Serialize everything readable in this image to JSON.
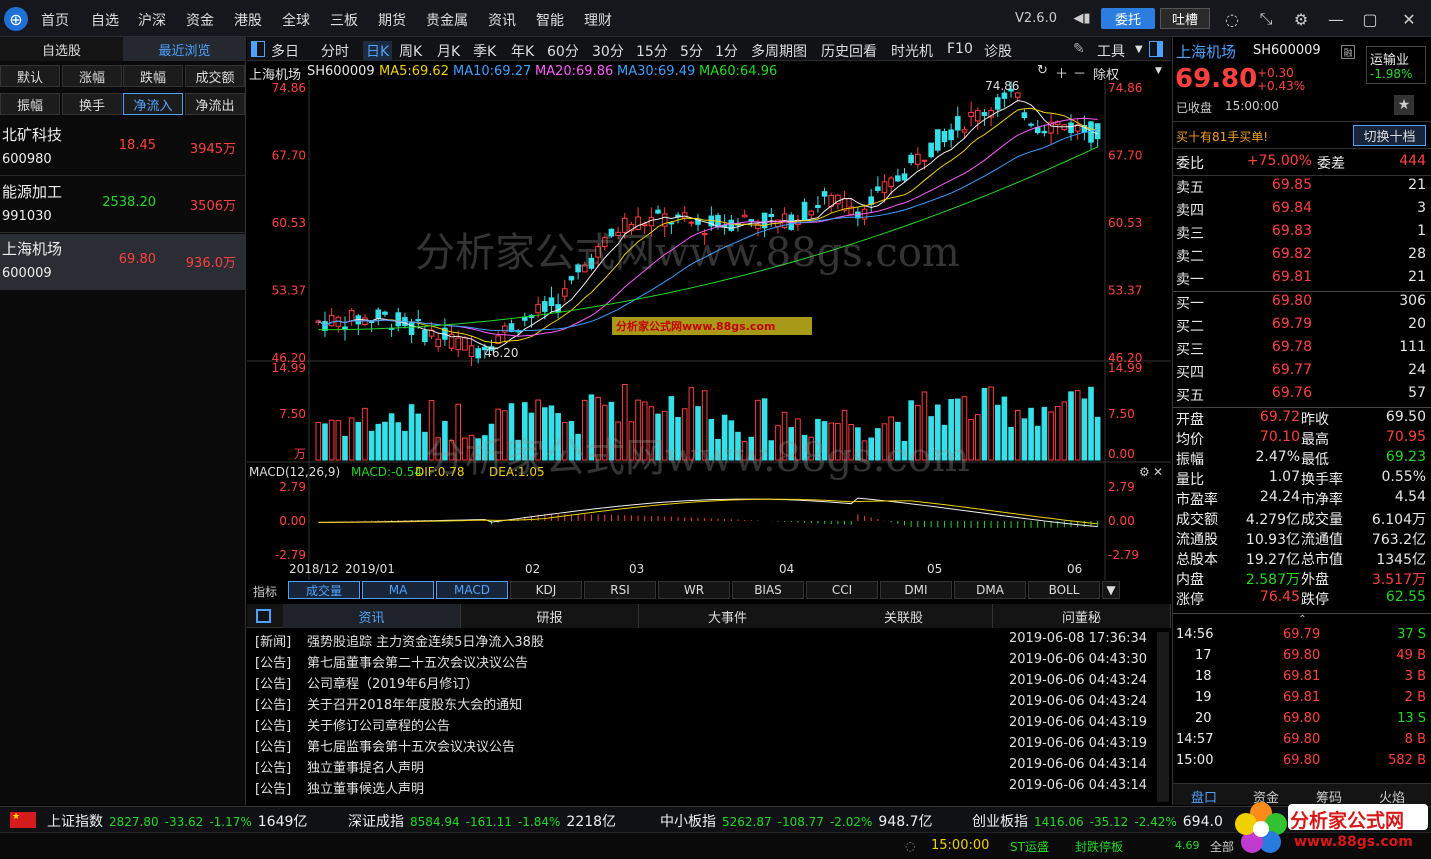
{
  "topnav": {
    "items": [
      "首页",
      "自选",
      "沪深",
      "资金",
      "港股",
      "全球",
      "三板",
      "期货",
      "贵金属",
      "资讯",
      "智能",
      "理财"
    ],
    "version": "V2.6.0",
    "weituo": "委托",
    "tucao": "吐槽"
  },
  "left": {
    "tabs": [
      "自选股",
      "最近浏览"
    ],
    "sort_row1": [
      "默认",
      "涨幅",
      "跌幅",
      "成交额"
    ],
    "sort_row2": [
      "振幅",
      "换手",
      "净流入",
      "净流出"
    ],
    "stocks": [
      {
        "name": "北矿科技",
        "code": "600980",
        "price": "18.45",
        "amount": "3945万",
        "color": "#ff4040"
      },
      {
        "name": "能源加工",
        "code": "991030",
        "price": "2538.20",
        "amount": "3506万",
        "color": "#22d822"
      },
      {
        "name": "上海机场",
        "code": "600009",
        "price": "69.80",
        "amount": "936.0万",
        "color": "#ff4040"
      }
    ]
  },
  "toolbar": {
    "periods": [
      "多日",
      "分时",
      "日K",
      "周K",
      "月K",
      "季K",
      "年K",
      "60分",
      "30分",
      "15分",
      "5分",
      "1分",
      "多周期图",
      "历史回看",
      "时光机",
      "F10",
      "诊股"
    ],
    "tools": "工具",
    "fuquan": "除权"
  },
  "chart_info": {
    "name": "上海机场",
    "code": "SH600009",
    "ma5": "MA5:69.62",
    "ma10": "MA10:69.27",
    "ma20": "MA20:69.86",
    "ma30": "MA30:69.49",
    "ma60": "MA60:64.96"
  },
  "chart_data": {
    "type": "candlestick",
    "price_ticks": [
      "74.86",
      "67.70",
      "60.53",
      "53.37",
      "46.20"
    ],
    "volume_ticks": [
      "14.99",
      "7.50",
      "万"
    ],
    "volume_ticks_right": [
      "14.99",
      "7.50",
      "0.00"
    ],
    "macd_ticks": [
      "2.79",
      "0.00",
      "-2.79"
    ],
    "x_ticks": [
      "2018/12",
      "2019/01",
      "02",
      "03",
      "04",
      "05",
      "06"
    ],
    "high_label": "74.86",
    "low_label": "46.20",
    "macd_title": "MACD(12,26,9)",
    "macd_vals": [
      "MACD:-0.54",
      "DIF:0.78",
      "DEA:1.05"
    ],
    "colors": {
      "up": "#ff3b3b",
      "down": "#35e0e8",
      "ma5": "#f0f0f0",
      "ma10": "#f0d200",
      "ma20": "#ff5cff",
      "ma30": "#3aa0ff",
      "ma60": "#22d822"
    }
  },
  "indicator_tabs": [
    "成交量",
    "MA",
    "MACD",
    "KDJ",
    "RSI",
    "WR",
    "BIAS",
    "CCI",
    "DMI",
    "DMA",
    "BOLL"
  ],
  "indicator_label": "指标",
  "watermark": "分析家公式网www.88gs.com",
  "watermark_small": "分析家公式网www.88gs.com",
  "news": {
    "tabs": [
      "资讯",
      "研报",
      "大事件",
      "关联股",
      "问董秘"
    ],
    "items": [
      {
        "tag": "[新闻]",
        "title": "强势股追踪 主力资金连续5日净流入38股",
        "date": "2019-06-08 17:36:34"
      },
      {
        "tag": "[公告]",
        "title": "第七届董事会第二十五次会议决议公告",
        "date": "2019-06-06 04:43:30"
      },
      {
        "tag": "[公告]",
        "title": "公司章程（2019年6月修订）",
        "date": "2019-06-06 04:43:24"
      },
      {
        "tag": "[公告]",
        "title": "关于召开2018年年度股东大会的通知",
        "date": "2019-06-06 04:43:24"
      },
      {
        "tag": "[公告]",
        "title": "关于修订公司章程的公告",
        "date": "2019-06-06 04:43:19"
      },
      {
        "tag": "[公告]",
        "title": "第七届监事会第十五次会议决议公告",
        "date": "2019-06-06 04:43:19"
      },
      {
        "tag": "[公告]",
        "title": "独立董事提名人声明",
        "date": "2019-06-06 04:43:14"
      },
      {
        "tag": "[公告]",
        "title": "独立董事候选人声明",
        "date": "2019-06-06 04:43:14"
      }
    ]
  },
  "right": {
    "name": "上海机场",
    "code": "SH600009",
    "price": "69.80",
    "change": "+0.30",
    "pct": "+0.43%",
    "status": "已收盘",
    "time": "15:00:00",
    "flag": "运输业",
    "flag_pct": "-1.98%",
    "buy_note": "买十有81手买单!",
    "switch": "切换十档",
    "weibi_label": "委比",
    "weibi": "+75.00%",
    "weicha_label": "委差",
    "weicha": "444",
    "asks": [
      {
        "label": "卖五",
        "price": "69.85",
        "vol": "21"
      },
      {
        "label": "卖四",
        "price": "69.84",
        "vol": "3"
      },
      {
        "label": "卖三",
        "price": "69.83",
        "vol": "1"
      },
      {
        "label": "卖二",
        "price": "69.82",
        "vol": "28"
      },
      {
        "label": "卖一",
        "price": "69.81",
        "vol": "21"
      }
    ],
    "bids": [
      {
        "label": "买一",
        "price": "69.80",
        "vol": "306"
      },
      {
        "label": "买二",
        "price": "69.79",
        "vol": "20"
      },
      {
        "label": "买三",
        "price": "69.78",
        "vol": "111"
      },
      {
        "label": "买四",
        "price": "69.77",
        "vol": "24"
      },
      {
        "label": "买五",
        "price": "69.76",
        "vol": "57"
      }
    ],
    "stats": [
      {
        "k1": "开盘",
        "v1": "69.72",
        "c1": "#ff4040",
        "k2": "昨收",
        "v2": "69.50",
        "c2": "#e6e6e6"
      },
      {
        "k1": "均价",
        "v1": "70.10",
        "c1": "#ff4040",
        "k2": "最高",
        "v2": "70.95",
        "c2": "#ff4040"
      },
      {
        "k1": "振幅",
        "v1": "2.47%",
        "c1": "#e6e6e6",
        "k2": "最低",
        "v2": "69.23",
        "c2": "#22d822"
      },
      {
        "k1": "量比",
        "v1": "1.07",
        "c1": "#e6e6e6",
        "k2": "换手率",
        "v2": "0.55%",
        "c2": "#e6e6e6"
      },
      {
        "k1": "市盈率",
        "v1": "24.24",
        "c1": "#e6e6e6",
        "k2": "市净率",
        "v2": "4.54",
        "c2": "#e6e6e6"
      },
      {
        "k1": "成交额",
        "v1": "4.279亿",
        "c1": "#e6e6e6",
        "k2": "成交量",
        "v2": "6.104万",
        "c2": "#e6e6e6"
      },
      {
        "k1": "流通股",
        "v1": "10.93亿",
        "c1": "#e6e6e6",
        "k2": "流通值",
        "v2": "763.2亿",
        "c2": "#e6e6e6"
      },
      {
        "k1": "总股本",
        "v1": "19.27亿",
        "c1": "#e6e6e6",
        "k2": "总市值",
        "v2": "1345亿",
        "c2": "#e6e6e6"
      },
      {
        "k1": "内盘",
        "v1": "2.587万",
        "c1": "#22d822",
        "k2": "外盘",
        "v2": "3.517万",
        "c2": "#ff4040"
      },
      {
        "k1": "涨停",
        "v1": "76.45",
        "c1": "#ff4040",
        "k2": "跌停",
        "v2": "62.55",
        "c2": "#22d822"
      }
    ],
    "ticks": [
      {
        "t": "14:56",
        "p": "69.79",
        "v": "37 S",
        "vc": "#22d822"
      },
      {
        "t": "17",
        "p": "69.80",
        "v": "49 B",
        "vc": "#ff4040"
      },
      {
        "t": "18",
        "p": "69.81",
        "v": "3 B",
        "vc": "#ff4040"
      },
      {
        "t": "19",
        "p": "69.81",
        "v": "2 B",
        "vc": "#ff4040"
      },
      {
        "t": "20",
        "p": "69.80",
        "v": "13 S",
        "vc": "#22d822"
      },
      {
        "t": "14:57",
        "p": "69.80",
        "v": "8 B",
        "vc": "#ff4040"
      },
      {
        "t": "15:00",
        "p": "69.80",
        "v": "582 B",
        "vc": "#ff4040"
      }
    ],
    "bottom_tabs": [
      "盘口",
      "资金",
      "筹码",
      "火焰"
    ]
  },
  "indices": [
    {
      "name": "上证指数",
      "price": "2827.80",
      "chg": "-33.62",
      "pct": "-1.17%",
      "amt": "1649亿"
    },
    {
      "name": "深证成指",
      "price": "8584.94",
      "chg": "-161.11",
      "pct": "-1.84%",
      "amt": "2218亿"
    },
    {
      "name": "中小板指",
      "price": "5262.87",
      "chg": "-108.77",
      "pct": "-2.02%",
      "amt": "948.7亿"
    },
    {
      "name": "创业板指",
      "price": "1416.06",
      "chg": "-35.12",
      "pct": "-2.42%",
      "amt": "694.0"
    }
  ],
  "statusbar": {
    "time": "15:00:00",
    "st": "ST运盛",
    "st2": "封跌停板",
    "num": "4.69",
    "last": "全部"
  },
  "brand": {
    "text": "分析家公式网",
    "url": "www.88gs.com"
  }
}
